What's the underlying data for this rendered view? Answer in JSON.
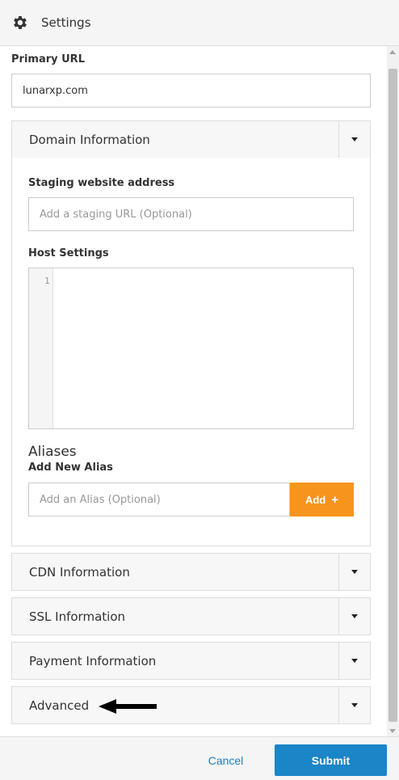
{
  "header": {
    "title": "Settings",
    "icon": "gear-icon"
  },
  "primary_url": {
    "label": "Primary URL",
    "value": "lunarxp.com"
  },
  "domain_panel": {
    "title": "Domain Information",
    "staging": {
      "label": "Staging website address",
      "placeholder": "Add a staging URL (Optional)"
    },
    "host_settings": {
      "label": "Host Settings",
      "line_number": "1"
    },
    "aliases": {
      "title": "Aliases",
      "add_label": "Add New Alias",
      "placeholder": "Add an Alias (Optional)",
      "add_button": "Add",
      "add_icon": "+"
    }
  },
  "panels": [
    {
      "title": "CDN Information"
    },
    {
      "title": "SSL Information"
    },
    {
      "title": "Payment Information"
    },
    {
      "title": "Advanced"
    }
  ],
  "footer": {
    "cancel_label": "Cancel",
    "submit_label": "Submit"
  },
  "colors": {
    "accent_orange": "#f7941d",
    "submit_blue": "#1a85c7",
    "link_blue": "#1f7fbf"
  }
}
